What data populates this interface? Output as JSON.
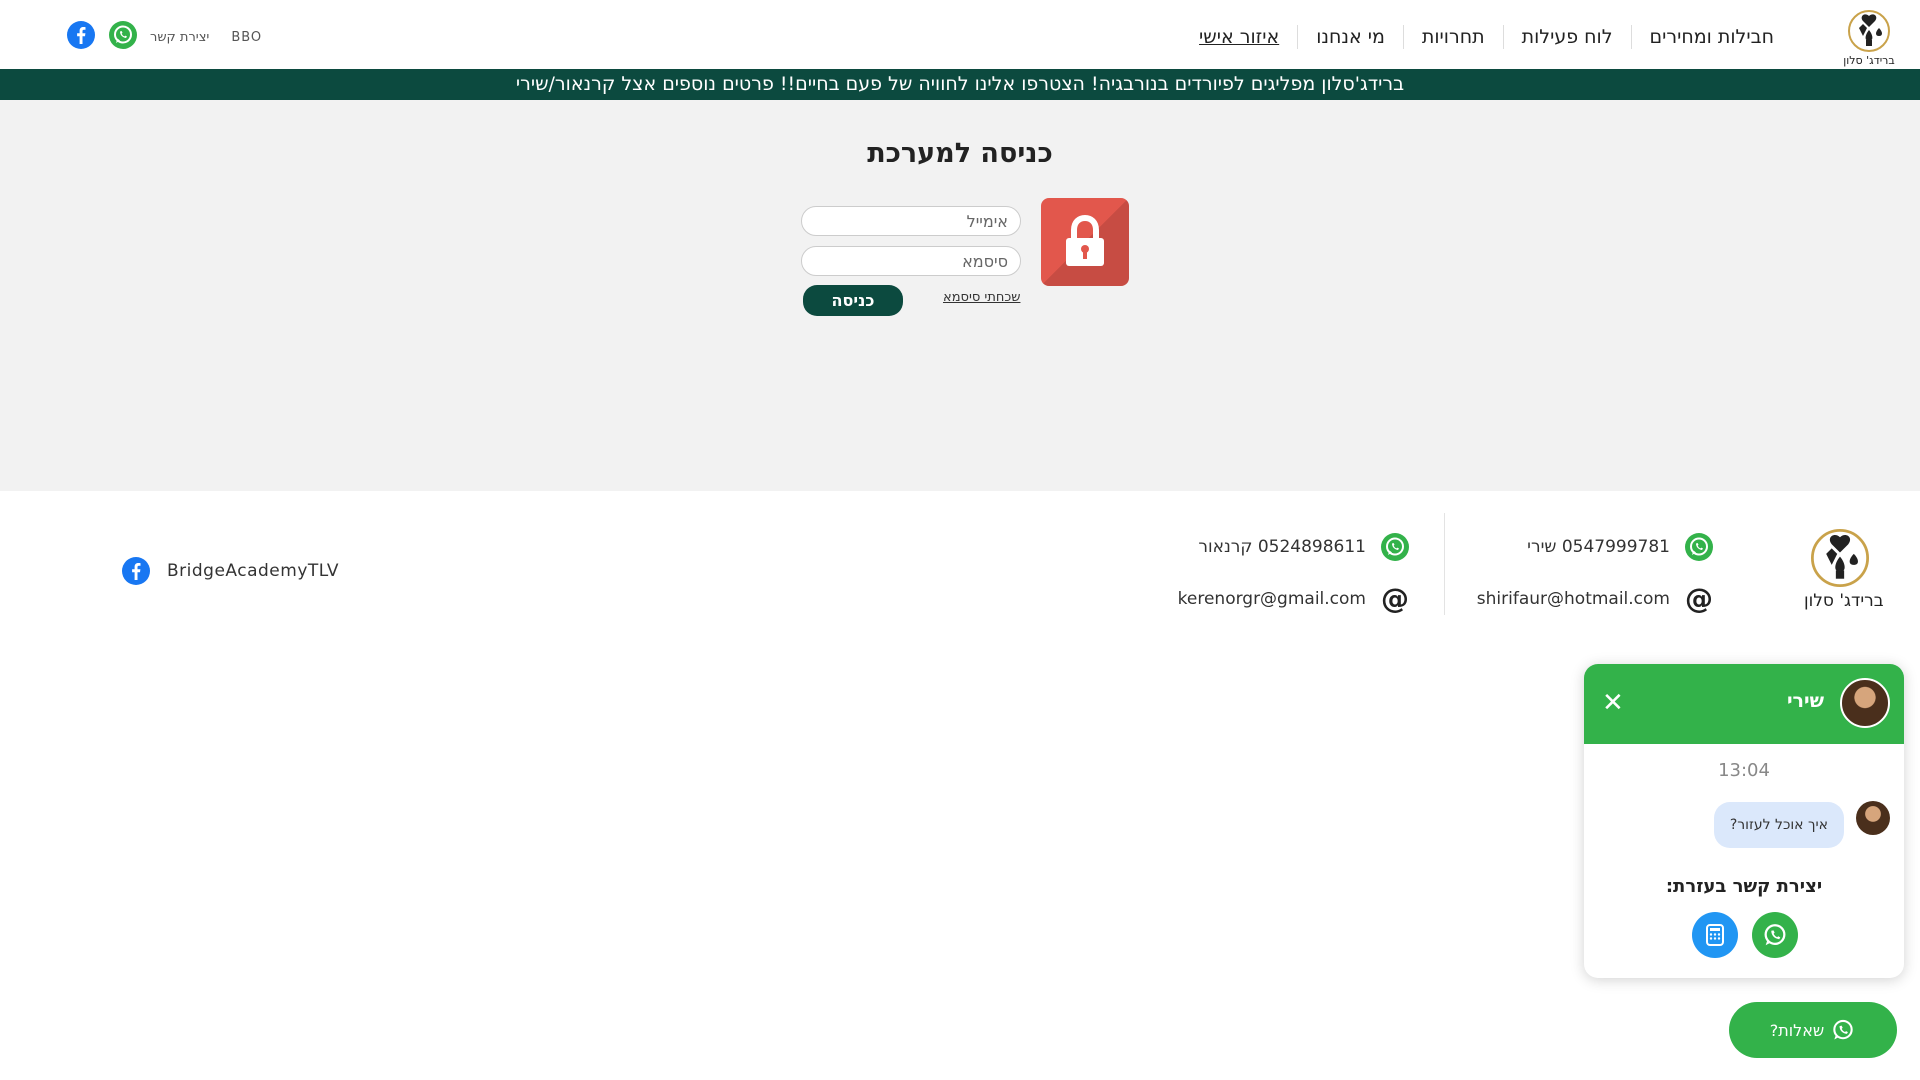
{
  "header": {
    "logo_text": "ברידג' סלון",
    "nav": [
      {
        "label": "חבילות ומחירים"
      },
      {
        "label": "לוח פעילות"
      },
      {
        "label": "תחרויות"
      },
      {
        "label": "מי אנחנו"
      },
      {
        "label": "איזור אישי"
      }
    ],
    "contact_link": "יצירת קשר",
    "bbo_link": "BBO"
  },
  "announcement": "ברידג'סלון מפליגים לפיורדים בנורבגיה! הצטרפו אלינו לחוויה של פעם בחיים!! פרטים נוספים אצל קרנאור/שירי",
  "login": {
    "title": "כניסה למערכת",
    "email_placeholder": "אימייל",
    "password_placeholder": "סיסמא",
    "submit_label": "כניסה",
    "forgot_label": "שכחתי סיסמא"
  },
  "footer": {
    "logo_text": "ברידג' סלון",
    "contact1_phone": "0547999781 שירי",
    "contact1_email": "shirifaur@hotmail.com",
    "contact2_phone": "0524898611 קרנאור",
    "contact2_email": "kerenorgr@gmail.com",
    "facebook": "BridgeAcademyTLV"
  },
  "chat": {
    "name": "שירי",
    "time": "13:04",
    "message": "איך אוכל לעזור?",
    "contact_label": "יצירת קשר בעזרת:",
    "questions_button": "שאלות?"
  },
  "colors": {
    "brand_green": "#0c4a3f",
    "whatsapp_green": "#33b24a",
    "lock_red": "#e2574c",
    "facebook_blue": "#1877f2"
  }
}
